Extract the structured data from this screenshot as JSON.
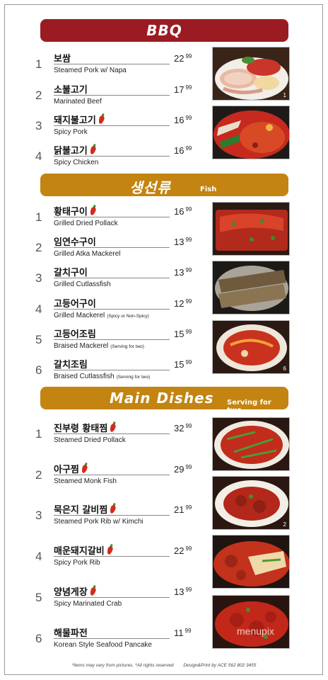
{
  "sections": {
    "bbq": {
      "title": "BBQ",
      "color": "#9b1b22"
    },
    "fish": {
      "title": "생선류",
      "subtitle": "Fish",
      "color": "#c38412"
    },
    "main": {
      "title": "Main Dishes",
      "subtitle": "Serving for two",
      "color": "#c38412"
    }
  },
  "bbq_items": [
    {
      "num": "1",
      "kr": "보쌈",
      "en": "Steamed Pork w/ Napa",
      "price": "22",
      "cents": "99",
      "spicy": false
    },
    {
      "num": "2",
      "kr": "소불고기",
      "en": "Marinated Beef",
      "price": "17",
      "cents": "99",
      "spicy": false
    },
    {
      "num": "3",
      "kr": "돼지불고기",
      "en": "Spicy Pork",
      "price": "16",
      "cents": "99",
      "spicy": true
    },
    {
      "num": "4",
      "kr": "닭불고기",
      "en": "Spicy Chicken",
      "price": "16",
      "cents": "99",
      "spicy": true
    }
  ],
  "fish_items": [
    {
      "num": "1",
      "kr": "황태구이",
      "en": "Grilled Dried Pollack",
      "note": "",
      "price": "16",
      "cents": "99",
      "spicy": true
    },
    {
      "num": "2",
      "kr": "임연수구이",
      "en": "Grilled Atka Mackerel",
      "note": "",
      "price": "13",
      "cents": "99",
      "spicy": false
    },
    {
      "num": "3",
      "kr": "갈치구이",
      "en": "Grilled Cutlassfish",
      "note": "",
      "price": "13",
      "cents": "99",
      "spicy": false
    },
    {
      "num": "4",
      "kr": "고등어구이",
      "en": "Grilled Mackerel",
      "note": "(Spicy or Non-Spicy)",
      "price": "12",
      "cents": "99",
      "spicy": false
    },
    {
      "num": "5",
      "kr": "고등어조림",
      "en": "Braised Mackerel",
      "note": "(Serving for two)",
      "price": "15",
      "cents": "99",
      "spicy": false
    },
    {
      "num": "6",
      "kr": "갈치조림",
      "en": "Braised Cutlassfish",
      "note": "(Serving for two)",
      "price": "15",
      "cents": "99",
      "spicy": false
    }
  ],
  "main_items": [
    {
      "num": "1",
      "kr": "진부령 황태찜",
      "en": "Steamed Dried Pollack",
      "price": "32",
      "cents": "99",
      "spicy": true
    },
    {
      "num": "2",
      "kr": "아구찜",
      "en": "Steamed Monk Fish",
      "price": "29",
      "cents": "99",
      "spicy": true
    },
    {
      "num": "3",
      "kr": "묵은지 갈비찜",
      "en": "Steamed Pork Rib w/ Kimchi",
      "price": "21",
      "cents": "99",
      "spicy": true
    },
    {
      "num": "4",
      "kr": "매운돼지갈비",
      "en": "Spicy Pork Rib",
      "price": "22",
      "cents": "99",
      "spicy": true
    },
    {
      "num": "5",
      "kr": "양념게장",
      "en": "Spicy Marinated Crab",
      "price": "13",
      "cents": "99",
      "spicy": true
    },
    {
      "num": "6",
      "kr": "해물파전",
      "en": "Korean Style Seafood Pancake",
      "price": "11",
      "cents": "99",
      "spicy": false
    }
  ],
  "photo_tags": {
    "bbq1": "1",
    "fish6": "6",
    "main2": "2"
  },
  "footer": {
    "disclaimer": "*Items may vary from pictures. *All rights reserved",
    "credit": "Design&Print by ACE 562 802 3455"
  },
  "watermark": "menupix"
}
